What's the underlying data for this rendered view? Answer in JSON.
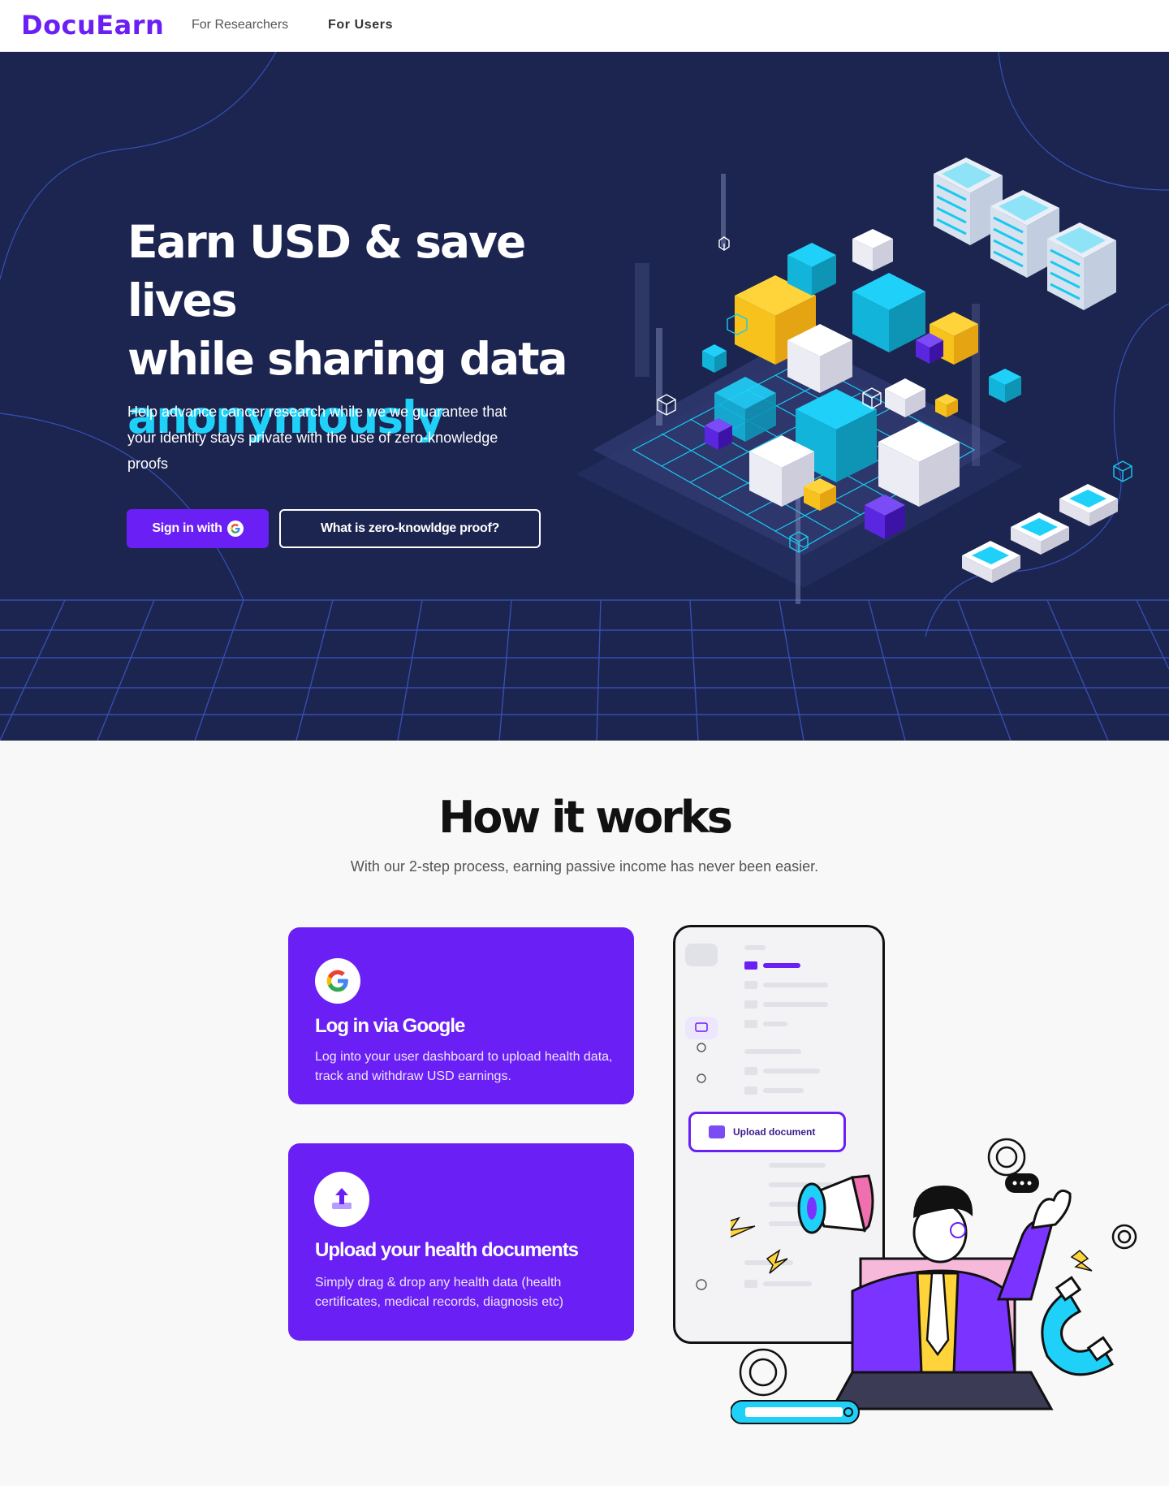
{
  "nav": {
    "logo": "DocuEarn",
    "links": [
      "For Researchers",
      "For Users"
    ]
  },
  "hero": {
    "title_line1": "Earn USD & save lives",
    "title_line2": "while sharing data",
    "title_accent": "anonymously",
    "subtitle": "Help advance cancer research while we we guarantee that your identity stays private with the use of zero-knowledge proofs",
    "signin_label": "Sign in with",
    "zkp_label": "What is zero-knowldge proof?"
  },
  "how": {
    "title": "How it works",
    "subtitle": "With our  2-step process, earning passive income has never been easier.",
    "steps": [
      {
        "title": "Log in via Google",
        "text": "Log into your user dashboard to upload health data, track and withdraw USD earnings."
      },
      {
        "title": "Upload your health documents",
        "text": "Simply drag & drop any health data (health certificates, medical records, diagnosis etc)"
      }
    ],
    "phone_button": "Upload document"
  },
  "colors": {
    "brand": "#6a1ff5",
    "hero_bg": "#1b2550",
    "accent": "#1fd1f9"
  },
  "icons": [
    "google-icon",
    "upload-icon",
    "cloud-icon"
  ]
}
